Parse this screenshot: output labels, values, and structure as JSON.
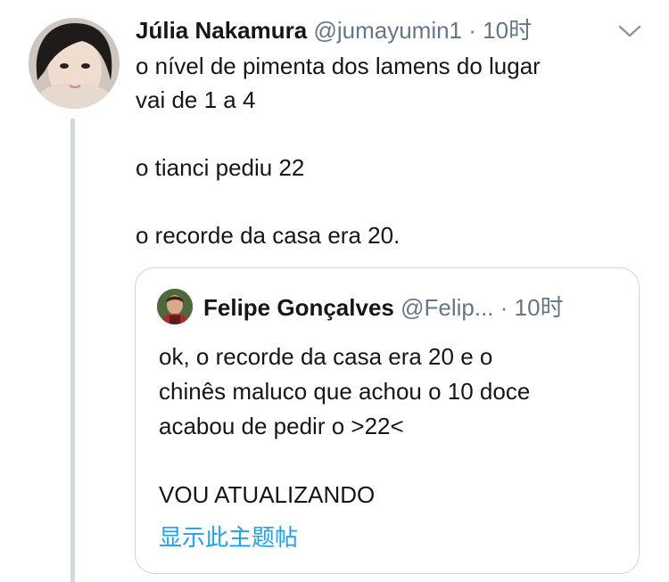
{
  "tweet": {
    "author_name": "Júlia Nakamura",
    "author_handle": "@jumayumin1",
    "separator": "·",
    "time": "10时",
    "lines": [
      "o nível de pimenta dos lamens do lugar",
      "vai de 1 a 4",
      "",
      "o tianci pediu 22",
      "",
      "o recorde da casa era 20."
    ]
  },
  "quoted_tweet": {
    "author_name": "Felipe Gonçalves",
    "author_handle": "@Felip...",
    "separator": "·",
    "time": "10时",
    "lines": [
      "ok, o recorde da casa era 20 e o",
      "chinês maluco que achou o 10 doce",
      "acabou de pedir o >22<",
      "",
      "VOU ATUALIZANDO"
    ],
    "show_thread": "显示此主题帖"
  },
  "icons": {
    "menu": "chevron-down-icon"
  },
  "colors": {
    "link": "#1da1f2",
    "secondary_text": "#657786",
    "thread_line": "#cfd9de"
  }
}
